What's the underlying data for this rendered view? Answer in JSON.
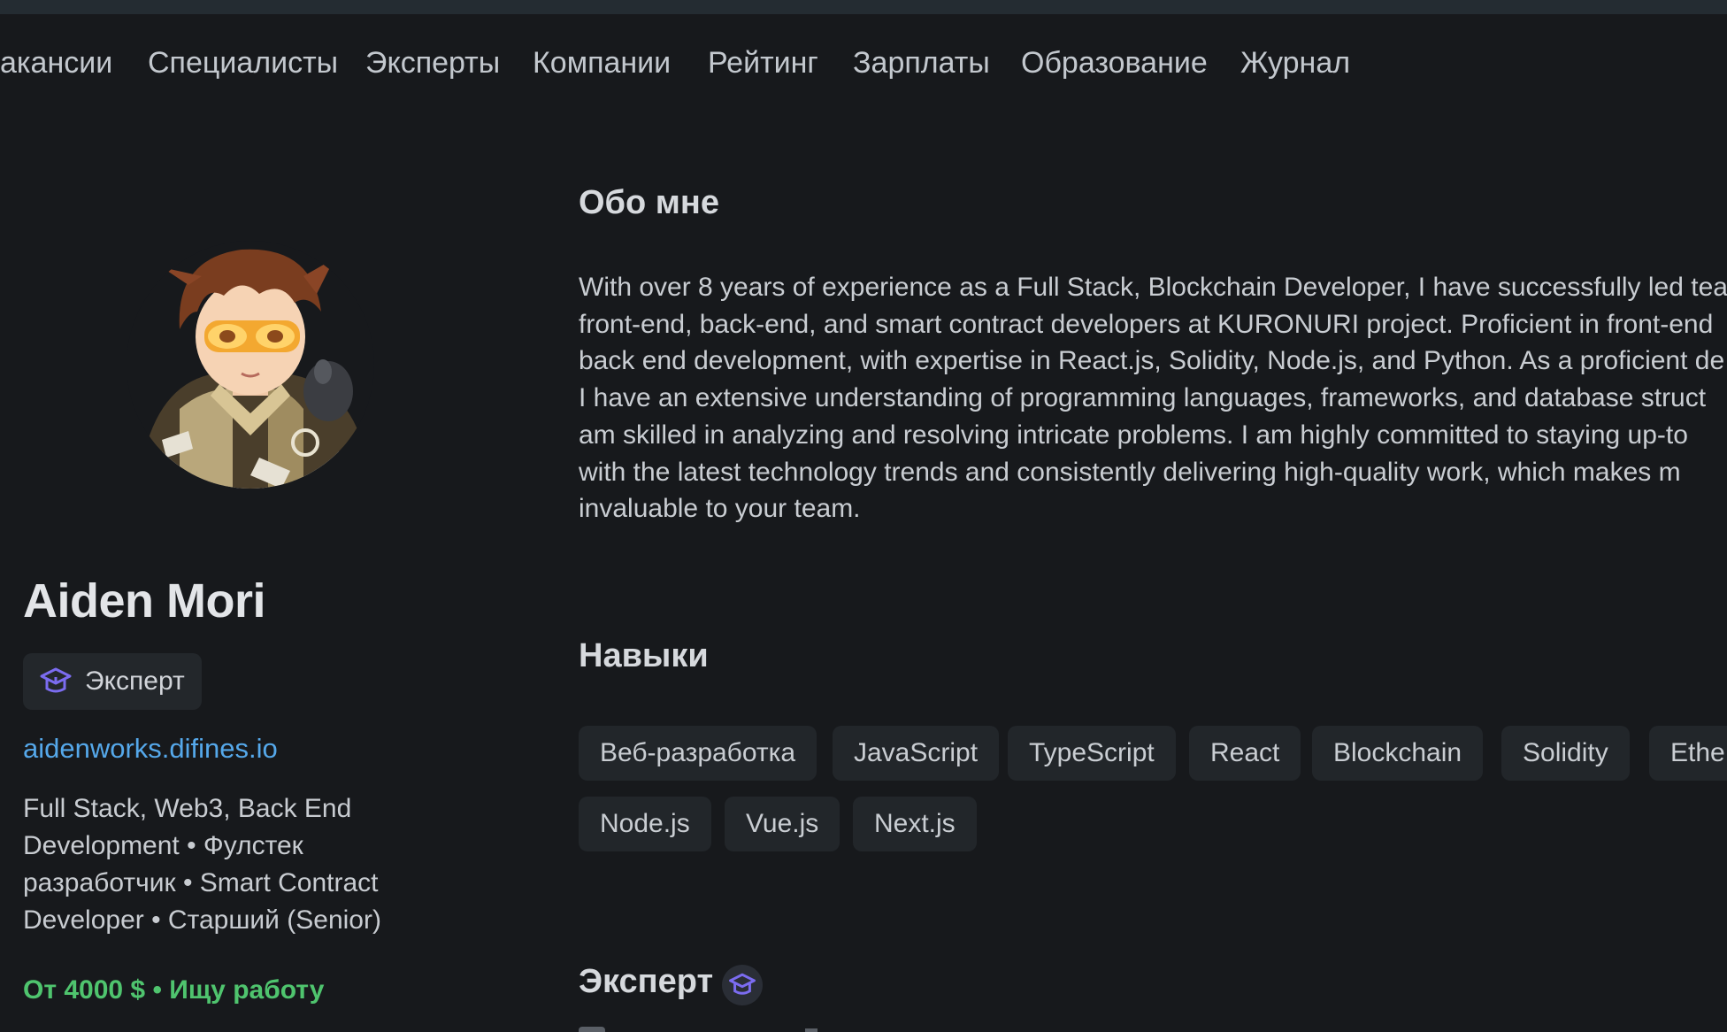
{
  "nav": {
    "items": [
      "акансии",
      "Специалисты",
      "Эксперты",
      "Компании",
      "Рейтинг",
      "Зарплаты",
      "Образование",
      "Журнал"
    ]
  },
  "profile": {
    "name": "Aiden Mori",
    "badge_label": "Эксперт",
    "website": "aidenworks.difines.io",
    "roles_lines": [
      "Full Stack, Web3, Back End",
      "Development • Фулстек",
      "разработчик • Smart Contract",
      "Developer • Старший (Senior)"
    ],
    "salary_status": "От 4000 $ • Ищу работу"
  },
  "about": {
    "title": "Обо мне",
    "lines": [
      "With over 8 years of experience as a Full Stack, Blockchain Developer, I have successfully led tea",
      "front-end, back-end, and smart contract developers at KURONURI project. Proficient in front-end",
      "back end development, with expertise in React.js, Solidity, Node.js, and Python. As a proficient de",
      "I have an extensive understanding of programming languages, frameworks, and database struct",
      "am skilled in analyzing and resolving intricate problems. I am highly committed to staying up-to",
      "with the latest technology trends and consistently delivering high-quality work, which makes m",
      "invaluable to your team."
    ]
  },
  "skills": {
    "title": "Навыки",
    "row1": [
      "Веб-разработка",
      "JavaScript",
      "TypeScript",
      "React",
      "Blockchain",
      "Solidity",
      "Ethe"
    ],
    "row2": [
      "Node.js",
      "Vue.js",
      "Next.js"
    ]
  },
  "expert_section": {
    "title": "Эксперт"
  },
  "colors": {
    "background": "#17191c",
    "topbar": "#242c32",
    "link": "#55a8ea",
    "salary": "#4fc46e",
    "badge_icon": "#7b6cf0",
    "chip_bg": "#22262a"
  },
  "icons": {
    "badge_icon": "graduation-cap-icon",
    "expert_section_icon": "graduation-cap-icon"
  }
}
